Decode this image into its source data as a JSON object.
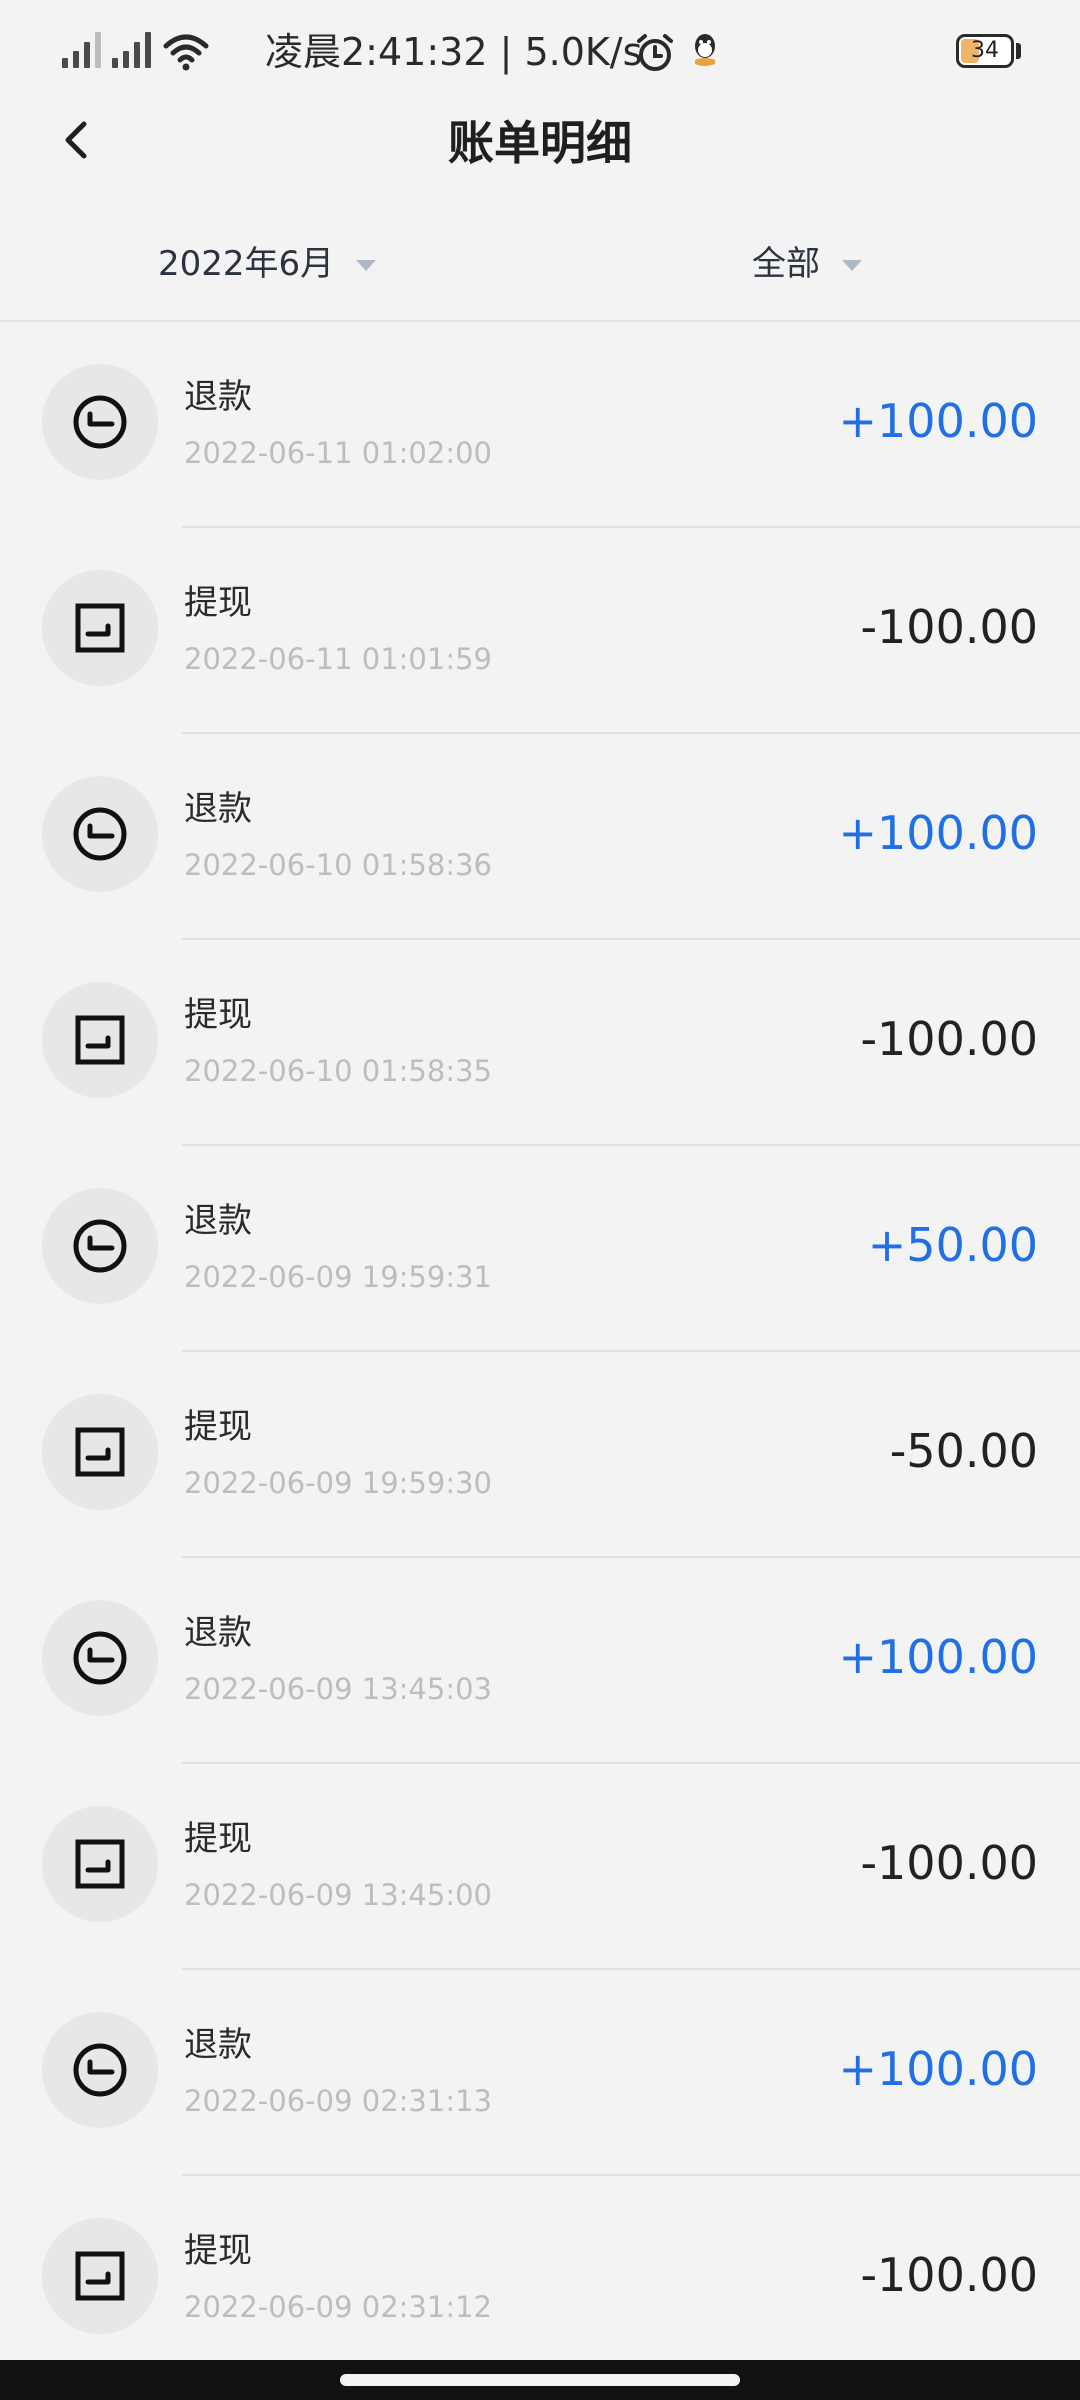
{
  "status_bar": {
    "time_text": "凌晨2:41:32 | 5.0K/s",
    "battery_level": "34",
    "icons": [
      "signal-icon",
      "signal-icon",
      "wifi-icon",
      "alarm-icon",
      "qq-icon",
      "battery-icon"
    ]
  },
  "header": {
    "title": "账单明细",
    "back_icon": "chevron-left-icon"
  },
  "filters": {
    "month_label": "2022年6月",
    "type_label": "全部"
  },
  "colors": {
    "income": "#1f6fe5",
    "expense": "#222222",
    "background": "#f3f3f3"
  },
  "transactions": [
    {
      "type": "refund",
      "title": "退款",
      "time": "2022-06-11 01:02:00",
      "amount": "+100.00"
    },
    {
      "type": "withdraw",
      "title": "提现",
      "time": "2022-06-11 01:01:59",
      "amount": "-100.00"
    },
    {
      "type": "refund",
      "title": "退款",
      "time": "2022-06-10 01:58:36",
      "amount": "+100.00"
    },
    {
      "type": "withdraw",
      "title": "提现",
      "time": "2022-06-10 01:58:35",
      "amount": "-100.00"
    },
    {
      "type": "refund",
      "title": "退款",
      "time": "2022-06-09 19:59:31",
      "amount": "+50.00"
    },
    {
      "type": "withdraw",
      "title": "提现",
      "time": "2022-06-09 19:59:30",
      "amount": "-50.00"
    },
    {
      "type": "refund",
      "title": "退款",
      "time": "2022-06-09 13:45:03",
      "amount": "+100.00"
    },
    {
      "type": "withdraw",
      "title": "提现",
      "time": "2022-06-09 13:45:00",
      "amount": "-100.00"
    },
    {
      "type": "refund",
      "title": "退款",
      "time": "2022-06-09 02:31:13",
      "amount": "+100.00"
    },
    {
      "type": "withdraw",
      "title": "提现",
      "time": "2022-06-09 02:31:12",
      "amount": "-100.00"
    }
  ]
}
